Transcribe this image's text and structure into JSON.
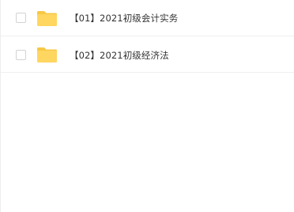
{
  "file_list": {
    "items": [
      {
        "name": "【01】2021初级会计实务",
        "type": "folder",
        "icon": "folder-icon",
        "checked": false
      },
      {
        "name": "【02】2021初级经济法",
        "type": "folder",
        "icon": "folder-icon",
        "checked": false
      }
    ]
  },
  "colors": {
    "folder": "#ffd660",
    "folder_tab": "#f7c845",
    "text": "#333333",
    "row_divider": "#f0f0f0",
    "checkbox_border": "#d3d3d3"
  }
}
